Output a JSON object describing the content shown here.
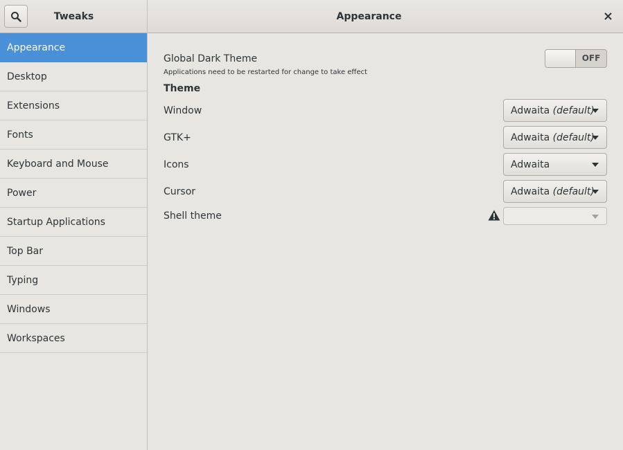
{
  "header": {
    "app_title": "Tweaks",
    "page_title": "Appearance",
    "search_icon": "search-icon",
    "close_icon": "close-icon"
  },
  "sidebar": {
    "items": [
      {
        "label": "Appearance",
        "selected": true
      },
      {
        "label": "Desktop"
      },
      {
        "label": "Extensions"
      },
      {
        "label": "Fonts"
      },
      {
        "label": "Keyboard and Mouse"
      },
      {
        "label": "Power"
      },
      {
        "label": "Startup Applications"
      },
      {
        "label": "Top Bar"
      },
      {
        "label": "Typing"
      },
      {
        "label": "Windows"
      },
      {
        "label": "Workspaces"
      }
    ]
  },
  "main": {
    "dark_theme": {
      "label": "Global Dark Theme",
      "hint": "Applications need to be restarted for change to take effect",
      "switch_state": "OFF"
    },
    "theme_section": "Theme",
    "window": {
      "label": "Window",
      "value": "Adwaita",
      "suffix": "(default)"
    },
    "gtk": {
      "label": "GTK+",
      "value": "Adwaita",
      "suffix": "(default)"
    },
    "icons": {
      "label": "Icons",
      "value": "Adwaita",
      "suffix": ""
    },
    "cursor": {
      "label": "Cursor",
      "value": "Adwaita",
      "suffix": "(default)"
    },
    "shell": {
      "label": "Shell theme",
      "value": "",
      "warning_icon": "warning-icon"
    }
  },
  "colors": {
    "accent": "#4a90d9",
    "background": "#e8e6e3",
    "text": "#2e3436"
  }
}
